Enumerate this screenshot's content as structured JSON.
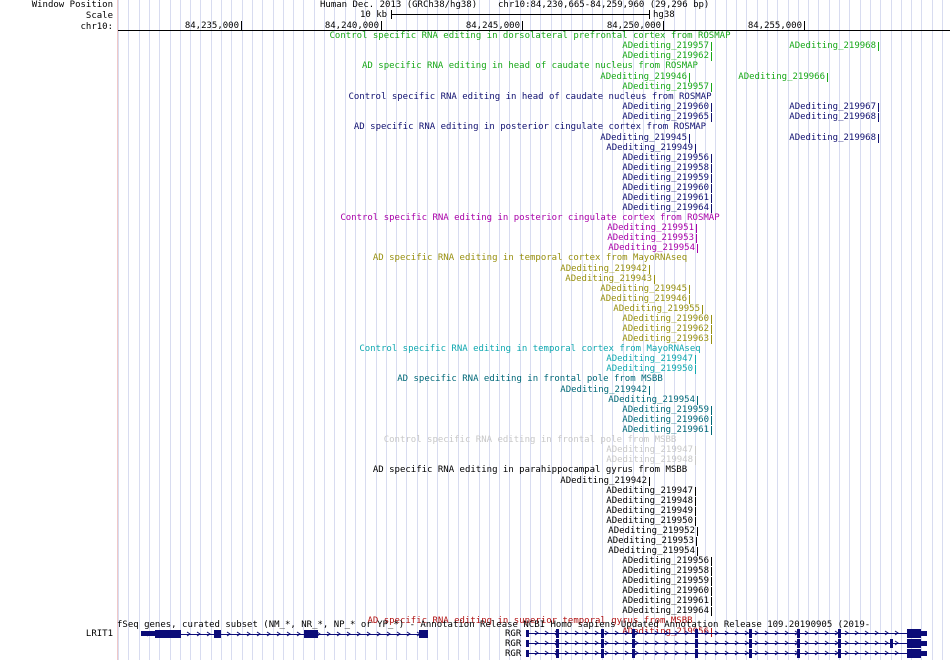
{
  "header": {
    "window_position_label": "Window Position",
    "scale_label": "Scale",
    "chrom_label": "chr10:",
    "assembly": "Human Dec. 2013 (GRCh38/hg38)",
    "position": "chr10:84,230,665-84,259,960 (29,296 bp)",
    "scale_text": "10 kb",
    "scale_db": "hg38",
    "ruler_ticks": [
      "84,235,000",
      "84,240,000",
      "84,245,000",
      "84,250,000",
      "84,255,000"
    ]
  },
  "colors": {
    "green": "#18a818",
    "navy": "#101070",
    "black": "#000000",
    "magenta": "#a800a8",
    "olive": "#989010",
    "cyan": "#10a8b0",
    "teal": "#006878",
    "gray": "#c8c8c8",
    "red": "#b01010",
    "gene": "#0c0c78"
  },
  "tracks": [
    {
      "title": "Control specific RNA editing in dorsolateral prefrontal cortex from ROSMAP",
      "color": "green",
      "rows": [
        [
          "ADediting_219957",
          "ADediting_219968"
        ],
        [
          "ADediting_219962"
        ]
      ]
    },
    {
      "title": "AD specific RNA editing in head of caudate nucleus from ROSMAP",
      "color": "green",
      "rows": [
        [
          "ADediting_219946",
          "ADediting_219966"
        ],
        [
          "ADediting_219957"
        ]
      ]
    },
    {
      "title": "Control specific RNA editing in head of caudate nucleus from ROSMAP",
      "color": "navy",
      "rows": [
        [
          "ADediting_219960",
          "ADediting_219967"
        ],
        [
          "ADediting_219965",
          "ADediting_219968"
        ]
      ]
    },
    {
      "title": "AD specific RNA editing in posterior cingulate cortex from ROSMAP",
      "color": "navy",
      "rows": [
        [
          "ADediting_219945",
          "ADediting_219968"
        ],
        [
          "ADediting_219949"
        ],
        [
          "ADediting_219956"
        ],
        [
          "ADediting_219958"
        ],
        [
          "ADediting_219959"
        ],
        [
          "ADediting_219960"
        ],
        [
          "ADediting_219961"
        ],
        [
          "ADediting_219964"
        ]
      ]
    },
    {
      "title": "Control specific RNA editing in posterior cingulate cortex from ROSMAP",
      "color": "magenta",
      "rows": [
        [
          "ADediting_219951"
        ],
        [
          "ADediting_219953"
        ],
        [
          "ADediting_219954"
        ]
      ]
    },
    {
      "title": "AD specific RNA editing in temporal cortex from MayoRNAseq",
      "color": "olive",
      "rows": [
        [
          "ADediting_219942"
        ],
        [
          "ADediting_219943"
        ],
        [
          "ADediting_219945"
        ],
        [
          "ADediting_219946"
        ],
        [
          "ADediting_219955"
        ],
        [
          "ADediting_219960"
        ],
        [
          "ADediting_219962"
        ],
        [
          "ADediting_219963"
        ]
      ]
    },
    {
      "title": "Control specific RNA editing in temporal cortex from MayoRNAseq",
      "color": "cyan",
      "rows": [
        [
          "ADediting_219947"
        ],
        [
          "ADediting_219950"
        ]
      ]
    },
    {
      "title": "AD specific RNA editing in frontal pole from MSBB",
      "color": "teal",
      "rows": [
        [
          "ADediting_219942"
        ],
        [
          "ADediting_219954"
        ],
        [
          "ADediting_219959"
        ],
        [
          "ADediting_219960"
        ],
        [
          "ADediting_219961"
        ]
      ]
    },
    {
      "title": "Control specific RNA editing in frontal pole from MSBB",
      "color": "gray",
      "rows": [
        [
          "ADediting_219947"
        ],
        [
          "ADediting_219948"
        ]
      ]
    },
    {
      "title": "AD specific RNA editing in parahippocampal gyrus from MSBB",
      "color": "black",
      "rows": [
        [
          "ADediting_219942"
        ],
        [
          "ADediting_219947"
        ],
        [
          "ADediting_219948"
        ],
        [
          "ADediting_219949"
        ],
        [
          "ADediting_219950"
        ],
        [
          "ADediting_219952"
        ],
        [
          "ADediting_219953"
        ],
        [
          "ADediting_219954"
        ],
        [
          "ADediting_219956"
        ],
        [
          "ADediting_219958"
        ],
        [
          "ADediting_219959"
        ],
        [
          "ADediting_219960"
        ],
        [
          "ADediting_219961"
        ],
        [
          "ADediting_219964"
        ]
      ]
    },
    {
      "title": "AD specific RNA editing in superior temporal gyrus from MSBB",
      "color": "red",
      "rows": [
        [
          "ADediting_219956"
        ]
      ]
    }
  ],
  "genes": {
    "title": "fSeq genes, curated subset (NM_*, NR_*, NP_* or YP_*) - Annotation Release NCBI Homo sapiens Updated Annotation Release 109.20190905 (2019-",
    "left_gene": "LRIT1",
    "rgr_labels": [
      "RGR",
      "RGR",
      "RGR"
    ]
  }
}
